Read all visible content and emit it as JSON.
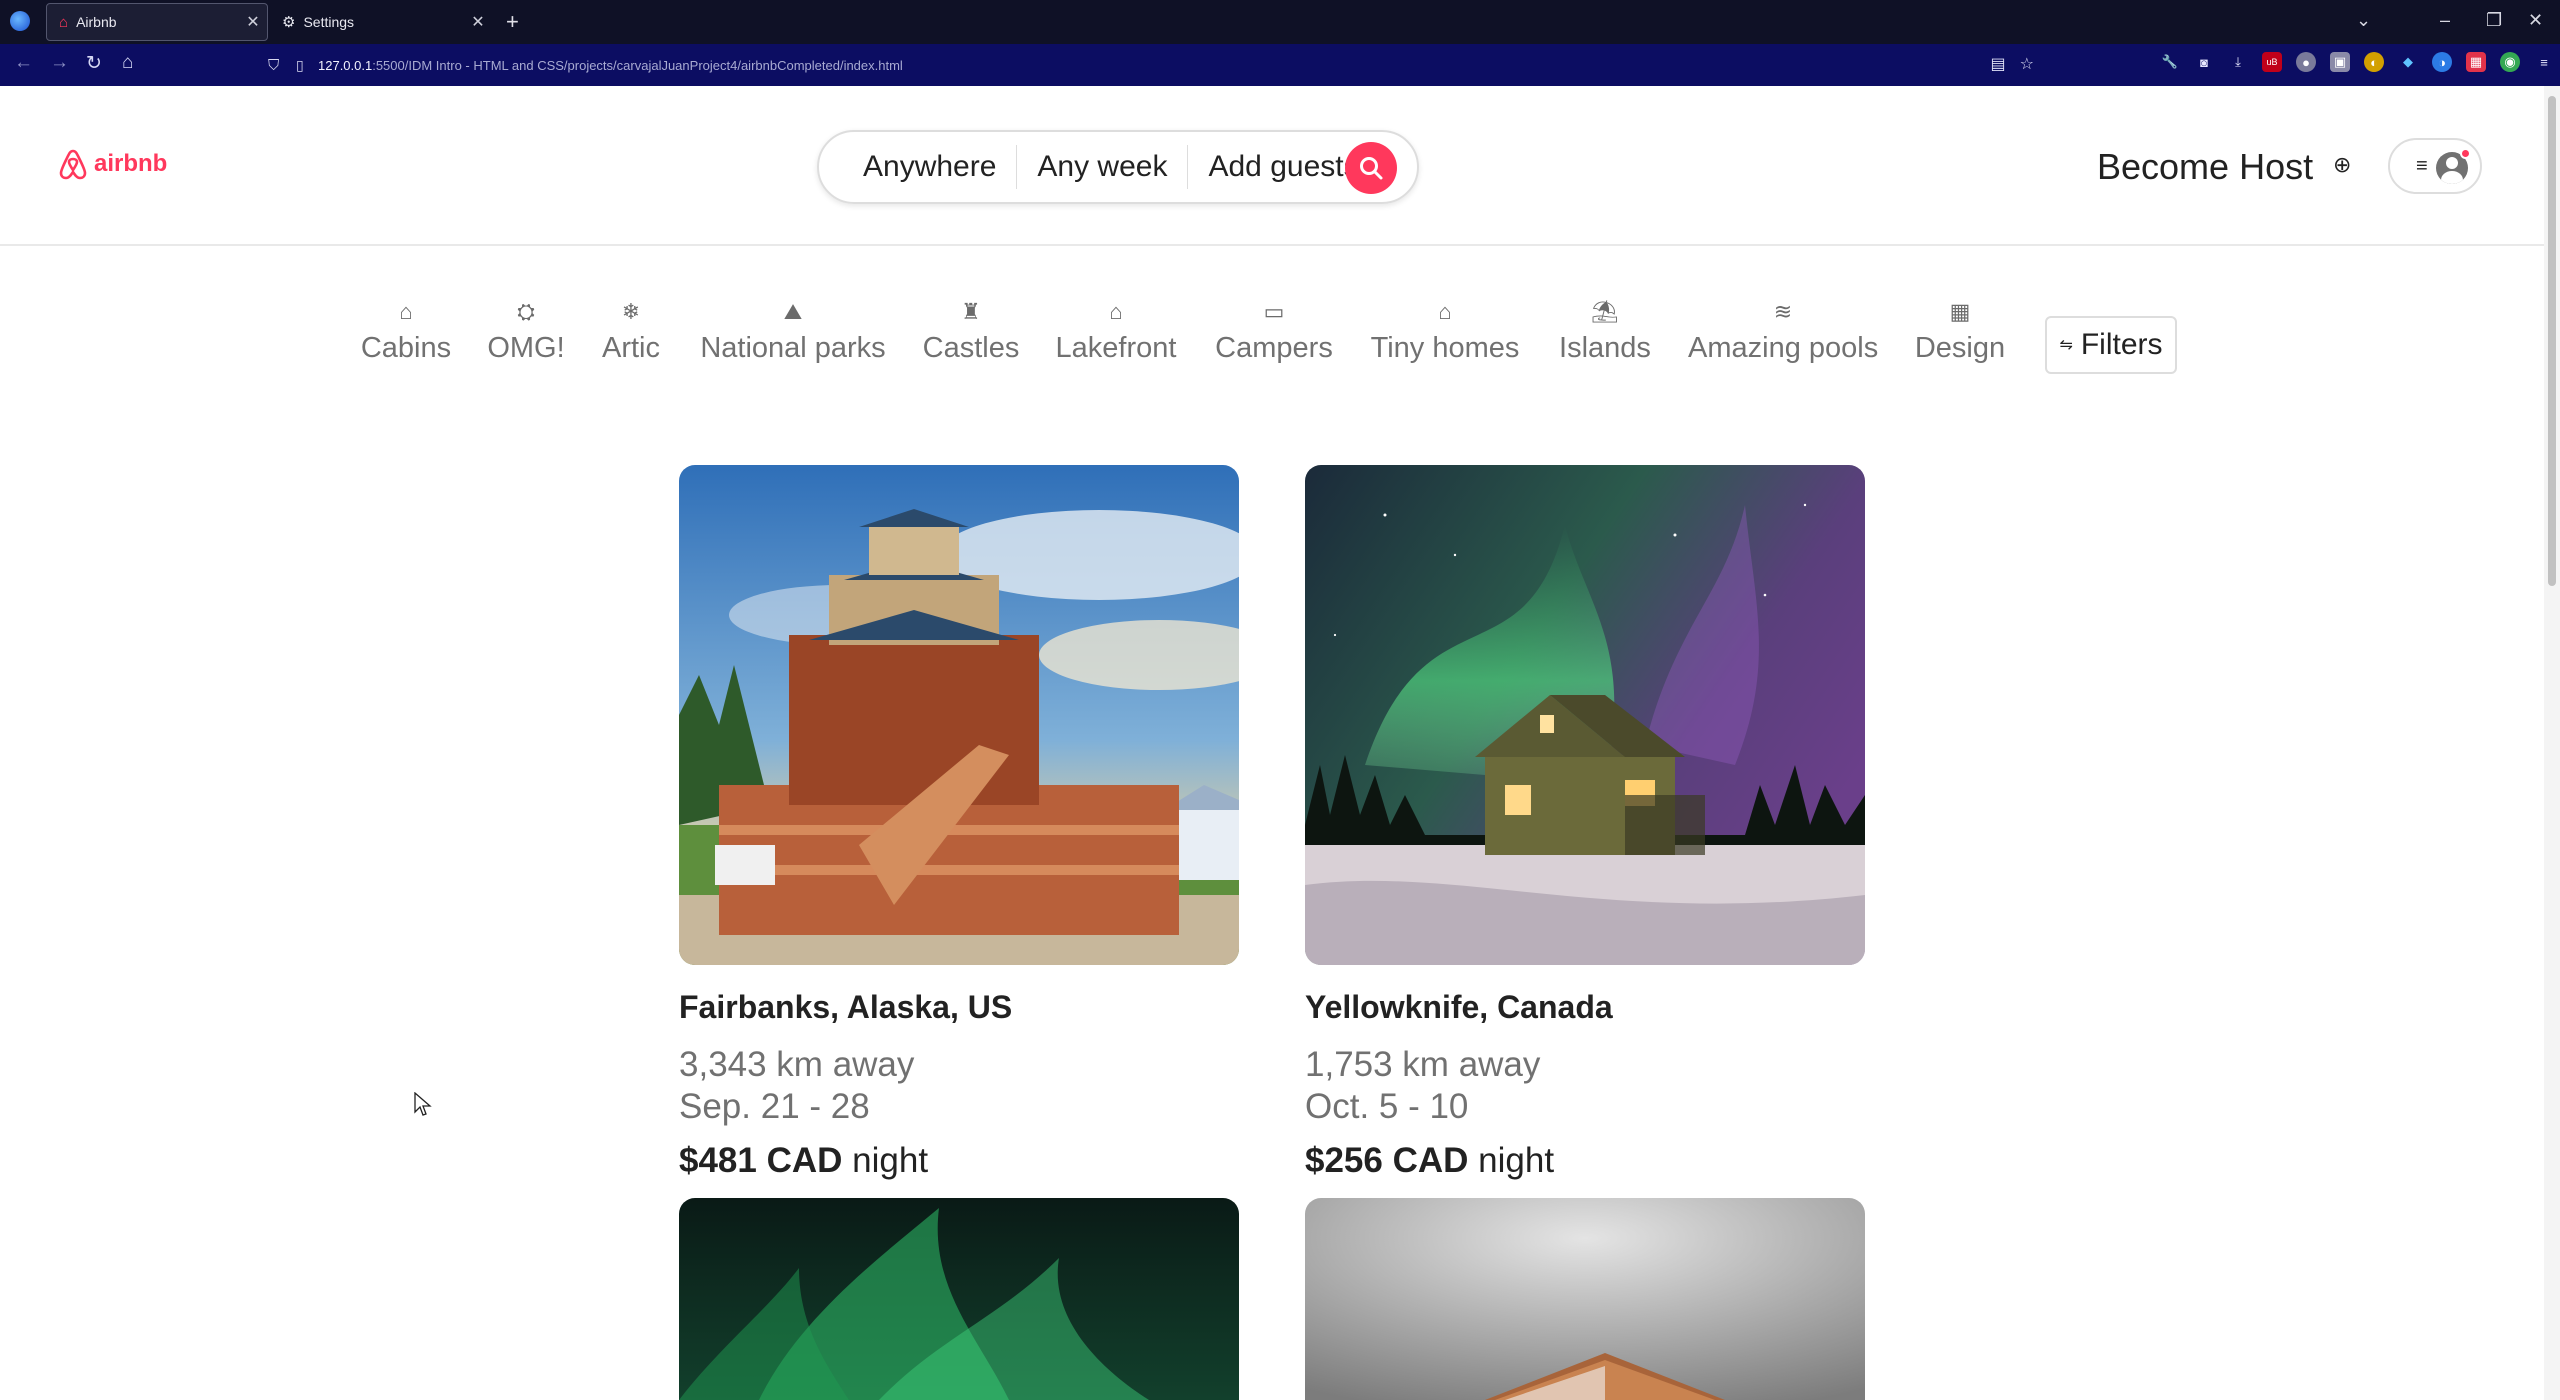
{
  "browser": {
    "tabs": [
      {
        "title": "Airbnb",
        "active": true
      },
      {
        "title": "Settings",
        "active": false
      }
    ],
    "url_host": "127.0.0.1",
    "url_path": ":5500/IDM Intro - HTML and CSS/projects/carvajalJuanProject4/airbnbCompleted/index.html"
  },
  "header": {
    "logo_text": "airbnb",
    "search": {
      "where": "Anywhere",
      "when": "Any week",
      "who": "Add guests"
    },
    "become_host": "Become Host",
    "menu_glyph": "≡"
  },
  "categories": [
    {
      "label": "Cabins",
      "icon": "cabin-icon"
    },
    {
      "label": "OMG!",
      "icon": "ufo-icon"
    },
    {
      "label": "Artic",
      "icon": "snowflake-icon"
    },
    {
      "label": "National parks",
      "icon": "park-icon"
    },
    {
      "label": "Castles",
      "icon": "castle-icon"
    },
    {
      "label": "Lakefront",
      "icon": "lakefront-icon"
    },
    {
      "label": "Campers",
      "icon": "camper-icon"
    },
    {
      "label": "Tiny homes",
      "icon": "tiny-home-icon"
    },
    {
      "label": "Islands",
      "icon": "island-icon"
    },
    {
      "label": "Amazing pools",
      "icon": "pool-icon"
    },
    {
      "label": "Design",
      "icon": "design-icon"
    }
  ],
  "filters_label": "Filters",
  "listings": [
    {
      "location": "Fairbanks, Alaska, US",
      "distance": "3,343 km away",
      "dates": "Sep. 21 - 28",
      "price": "$481 CAD",
      "price_unit": "night"
    },
    {
      "location": "Yellowknife, Canada",
      "distance": "1,753 km away",
      "dates": "Oct. 5 - 10",
      "price": "$256 CAD",
      "price_unit": "night"
    }
  ],
  "colors": {
    "brand": "#ff385c",
    "tab_bar": "#0f1126",
    "nav_bar": "#0c0d62"
  }
}
